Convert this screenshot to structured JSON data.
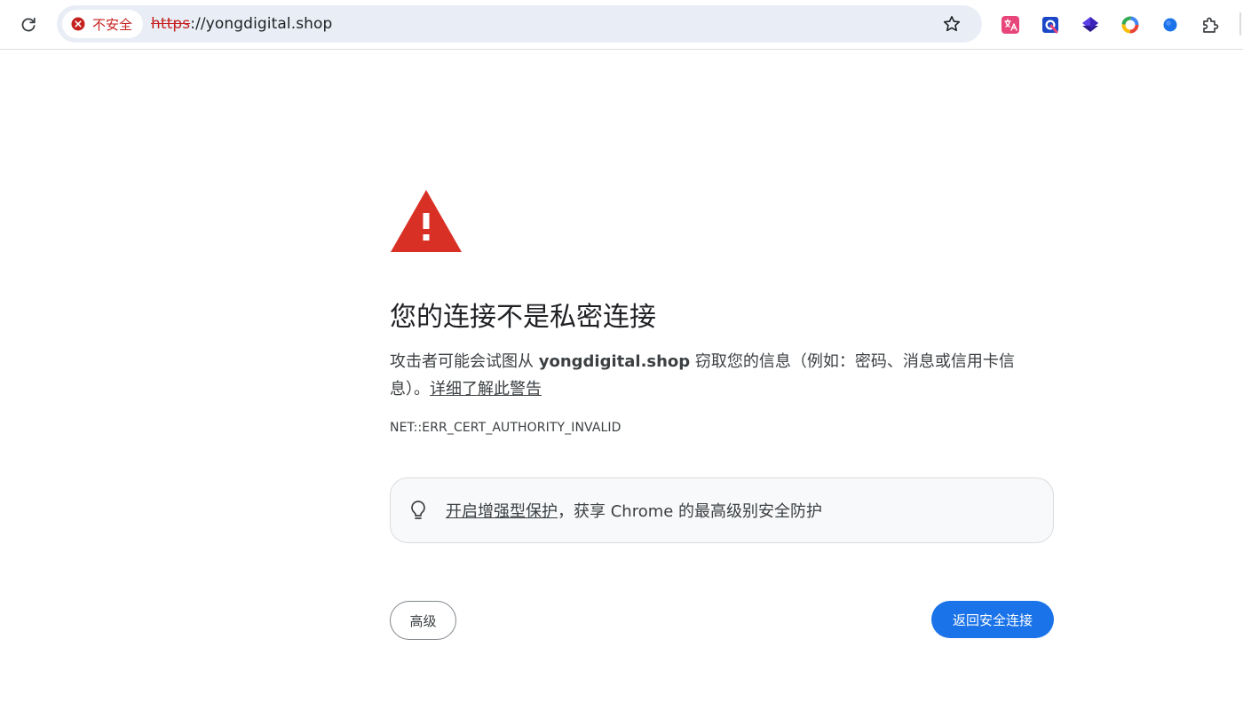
{
  "toolbar": {
    "reload_icon": "reload-icon",
    "security_chip": {
      "icon": "error-circle-icon",
      "label": "不安全",
      "color": "#c5221f"
    },
    "url": {
      "scheme": "https",
      "separator": "://",
      "host": "yongdigital.shop"
    },
    "bookmark_icon": "star-outline-icon",
    "extensions": [
      {
        "name": "translate-extension-icon",
        "color": "#e8457b"
      },
      {
        "name": "blue-extension-icon",
        "color": "#1a47c7"
      },
      {
        "name": "purple-diamond-extension-icon",
        "color": "#3b22b8"
      },
      {
        "name": "multicolor-ring-extension-icon",
        "color": "#fbbc04"
      },
      {
        "name": "blue-dot-extension-icon",
        "color": "#1a73e8"
      },
      {
        "name": "puzzle-icon",
        "color": "#3c4043"
      }
    ]
  },
  "interstitial": {
    "icon": "warning-triangle-icon",
    "icon_color": "#d93025",
    "heading": "您的连接不是私密连接",
    "explanation": {
      "prefix": "攻击者可能会试图从 ",
      "host": "yongdigital.shop",
      "suffix": " 窃取您的信息（例如：密码、消息或信用卡信息）。",
      "learn_more": "详细了解此警告"
    },
    "error_code": "NET::ERR_CERT_AUTHORITY_INVALID",
    "promo": {
      "icon": "lightbulb-icon",
      "link": "开启增强型保护",
      "rest": "，获享 Chrome 的最高级别安全防护"
    },
    "advanced_button": "高级",
    "back_button": "返回安全连接",
    "accent_color": "#1a73e8"
  }
}
